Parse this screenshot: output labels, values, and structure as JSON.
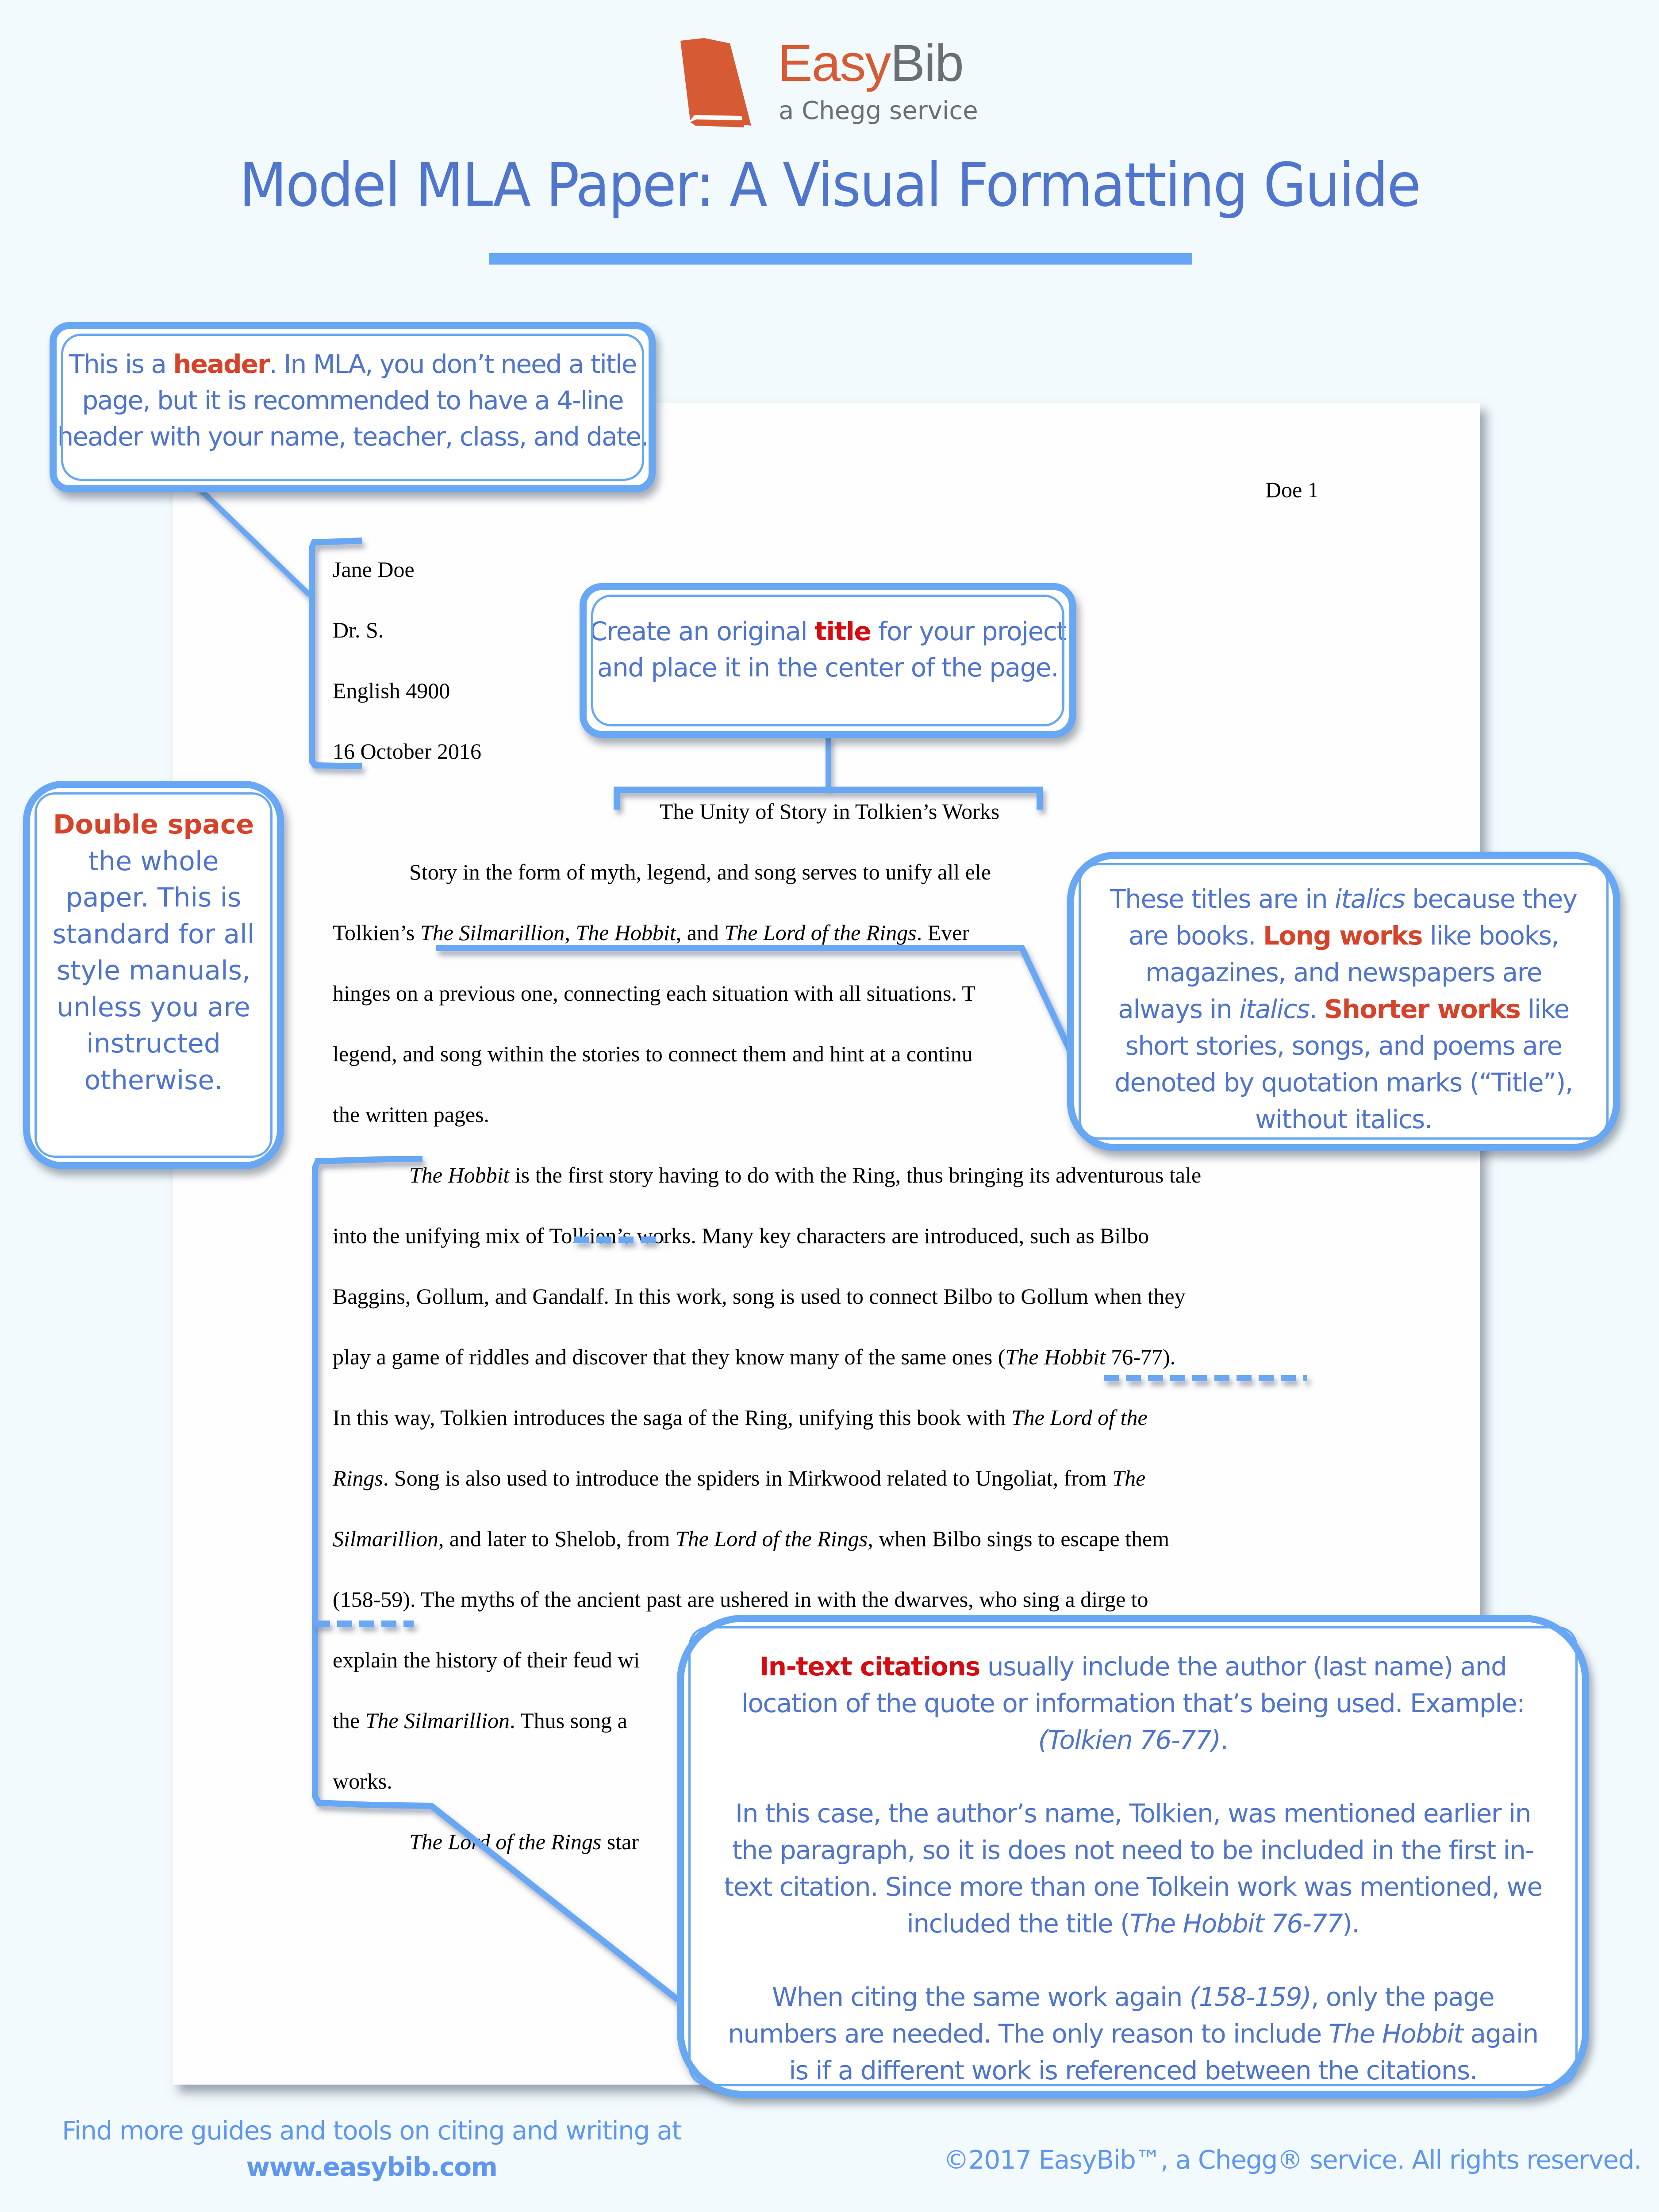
{
  "logo": {
    "brand_part1": "Easy",
    "brand_part2": "Bib",
    "tagline": "a Chegg service",
    "icon": "book-icon",
    "colors": {
      "brand_orange": "#d65a33",
      "brand_gray": "#6b6e72"
    }
  },
  "title": "Model MLA Paper: A Visual Formatting Guide",
  "colors": {
    "accent_blue": "#68a7f4",
    "callout_text": "#4e74cc",
    "emphasis_red": "#d4432a",
    "background": "#f2fafd"
  },
  "paper": {
    "page_header": "Doe 1",
    "heading_lines": [
      "Jane Doe",
      "Dr. S.",
      "English 4900",
      "16 October 2016"
    ],
    "paper_title": "The Unity of Story in Tolkien’s Works",
    "body_lines": [
      [
        {
          "t": "Story in the form of myth, legend, and song serves to unify all ele"
        }
      ],
      [
        {
          "t": "Tolkien’s "
        },
        {
          "t": "The Silmarillion",
          "i": true
        },
        {
          "t": ", "
        },
        {
          "t": "The Hobbit",
          "i": true
        },
        {
          "t": ", and "
        },
        {
          "t": "The Lord of the Rings",
          "i": true
        },
        {
          "t": ". Ever"
        }
      ],
      [
        {
          "t": "hinges on a previous one, connecting each situation with all situations. T"
        }
      ],
      [
        {
          "t": "legend, and song within the stories to connect them and hint at a continu"
        }
      ],
      [
        {
          "t": "the written pages."
        }
      ],
      [
        {
          "t": "The Hobbit",
          "i": true
        },
        {
          "t": " is the first story having to do with the Ring, thus bringing its adventurous tale"
        }
      ],
      [
        {
          "t": "into the unifying mix of Tolkien’s works. Many key characters are introduced, such as Bilbo"
        }
      ],
      [
        {
          "t": "Baggins, Gollum, and Gandalf. In this work, song is used to connect Bilbo to Gollum when they"
        }
      ],
      [
        {
          "t": "play a game of riddles and discover that they know many of the same ones ("
        },
        {
          "t": "The Hobbit",
          "i": true
        },
        {
          "t": " 76-77)."
        }
      ],
      [
        {
          "t": "In this way, Tolkien introduces the saga of the Ring, unifying this book with "
        },
        {
          "t": "The Lord of the",
          "i": true
        }
      ],
      [
        {
          "t": "Rings",
          "i": true
        },
        {
          "t": ". Song is also used to introduce the spiders in Mirkwood related to Ungoliat, from "
        },
        {
          "t": "The",
          "i": true
        }
      ],
      [
        {
          "t": "Silmarillion",
          "i": true
        },
        {
          "t": ", and later to Shelob, from "
        },
        {
          "t": "The Lord of the Rings",
          "i": true
        },
        {
          "t": ", when Bilbo sings to escape them"
        }
      ],
      [
        {
          "t": "(158-59). The myths of the ancient past are ushered in with the dwarves, who sing a dirge to"
        }
      ],
      [
        {
          "t": "explain the history of their feud wi"
        }
      ],
      [
        {
          "t": "the "
        },
        {
          "t": "The Silmarillion",
          "i": true
        },
        {
          "t": ". Thus song a"
        }
      ],
      [
        {
          "t": "works."
        }
      ],
      [
        {
          "t": "The Lord of the Rings",
          "i": true
        },
        {
          "t": " star"
        }
      ]
    ]
  },
  "callouts": {
    "header": [
      {
        "t": "This is a "
      },
      {
        "t": "header",
        "c": "red"
      },
      {
        "t": ". In MLA, you don’t need a title page, but it is recommended to have a 4-line header with your name, teacher, class, and date."
      }
    ],
    "title": [
      {
        "t": "Create an original "
      },
      {
        "t": "title",
        "c": "red2"
      },
      {
        "t": " for your project and place it in the center of the page."
      }
    ],
    "double_space": [
      {
        "t": "Double space",
        "c": "red"
      },
      {
        "t": " the whole paper. This is standard for all style manuals, unless you are instructed otherwise."
      }
    ],
    "italics": [
      {
        "t": "These titles are in "
      },
      {
        "t": "italics",
        "c": "it"
      },
      {
        "t": " because they are books. "
      },
      {
        "t": "Long works",
        "c": "red"
      },
      {
        "t": " like books, magazines, and newspapers are always in "
      },
      {
        "t": "italics",
        "c": "it"
      },
      {
        "t": ". "
      },
      {
        "t": "Shorter works",
        "c": "red"
      },
      {
        "t": " like short stories, songs, and poems are denoted by quotation marks (“Title”), without italics."
      }
    ],
    "intext_p1": [
      {
        "t": "In-text citations",
        "c": "red2"
      },
      {
        "t": " usually include the author (last name) and location of the quote or information that’s being used. Example: "
      },
      {
        "t": "(Tolkien 76-77)",
        "c": "it"
      },
      {
        "t": "."
      }
    ],
    "intext_p2": [
      {
        "t": "In this case, the author’s name, Tolkien, was mentioned earlier in the paragraph, so it is does not need to be included in the first in-text citation. Since more than one Tolkein work was mentioned, we included the title ("
      },
      {
        "t": "The Hobbit 76-77",
        "c": "it"
      },
      {
        "t": ")."
      }
    ],
    "intext_p3": [
      {
        "t": "When citing the same work again "
      },
      {
        "t": "(158-159)",
        "c": "it"
      },
      {
        "t": ", only the page numbers are needed. The only reason to include "
      },
      {
        "t": "The Hobbit",
        "c": "it"
      },
      {
        "t": " again is if a different work is referenced between the citations."
      }
    ]
  },
  "footer": {
    "left_line1": "Find more guides and tools on citing and writing at",
    "left_url": "www.easybib.com",
    "right": "©2017  EasyBib™, a Chegg® service. All rights reserved."
  }
}
